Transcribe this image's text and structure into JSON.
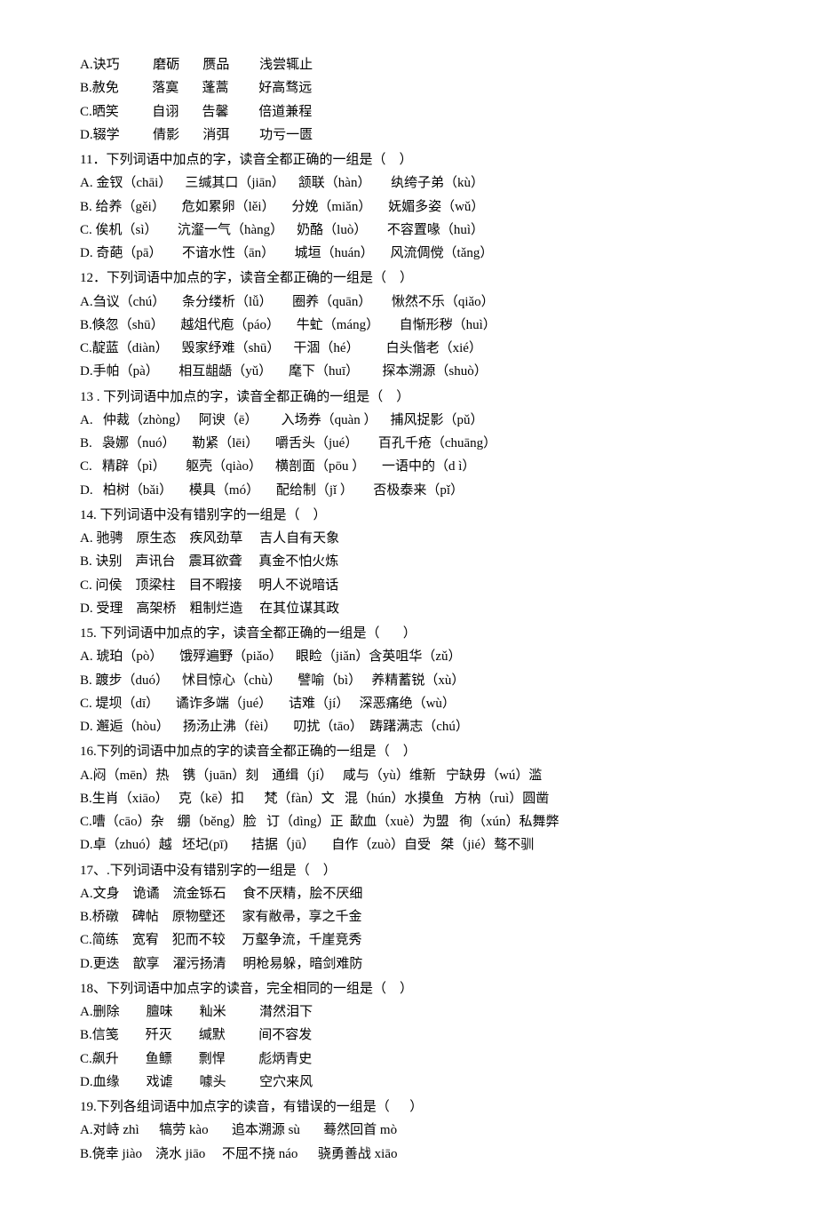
{
  "q10": {
    "optA": "A.诀巧          磨砺       赝品         浅尝辄止",
    "optB": "B.赦免          落寞       蓬蒿         好高骛远",
    "optC": "C.晒笑          自诩       告馨         倍道兼程",
    "optD": "D.辍学          倩影       消弭         功亏一匮"
  },
  "q11": {
    "stem": "11．下列词语中加点的字，读音全都正确的一组是（    ）",
    "optA": "A. 金钗（chāi）    三缄其口（jiān）    颔联（hàn）      纨绔子弟（kù）",
    "optB": "B. 给养（gěi）     危如累卵（lěi）     分娩（miǎn）     妩媚多姿（wǔ）",
    "optC": "C. 俟机（sì）      沆瀣一气（hàng）    奶酪（luò）      不容置喙（huì）",
    "optD": "D. 奇葩（pā）      不谙水性（ān）      城垣（huán）     风流倜傥（tǎng）"
  },
  "q12": {
    "stem": "12．下列词语中加点的字，读音全都正确的一组是（    ）",
    "optA": "A.刍议（chú）     条分缕析（lǚ）      圈养（quān）      愀然不乐（qiǎo）",
    "optB": "B.倏忽（shū）     越俎代庖（páo）     牛虻（máng）      自惭形秽（huì）",
    "optC": "C.靛蓝（diàn）    毁家纾难（shū）    干涸（hé）        白头偕老（xié）",
    "optD": "D.手帕（pà）      相互龃龉（yǔ）     麾下（huī）       探本溯源（shuò）"
  },
  "q13": {
    "stem": "13 . 下列词语中加点的字，读音全都正确的一组是（    ）",
    "optA": "A.   仲裁（zhòng）   阿谀（ē）       入场券（quàn ）    捕风捉影（pǔ）",
    "optB": "B.   袅娜（nuó）     勒紧（lēi）     嚼舌头（jué）      百孔千疮（chuāng）",
    "optC": "C.   精辟（pì）      躯壳（qiào）    横剖面（pōu ）     一语中的（d ì）",
    "optD": "D.   柏树（bǎi）     模具（mó）     配给制（jǐ ）      否极泰来（pǐ）"
  },
  "q14": {
    "stem": "14. 下列词语中没有错别字的一组是（    ）",
    "optA": "A. 驰骋    原生态    疾风劲草     吉人自有天象",
    "optB": "B. 诀别    声讯台    震耳欲聋     真金不怕火炼",
    "optC": "C. 问侯    顶梁柱    目不暇接     明人不说暗话",
    "optD": "D. 受理    高架桥    粗制烂造     在其位谋其政"
  },
  "q15": {
    "stem": "15. 下列词语中加点的字，读音全都正确的一组是（       ）",
    "optA": "A. 琥珀（pò）     饿殍遍野（piǎo）    眼睑（jiǎn）含英咀华（zǔ）",
    "optB": "B. 踱步（duó）    怵目惊心（chù）     譬喻（bì）   养精蓄锐（xù）",
    "optC": "C. 堤坝（dī）     谲诈多端（jué）     诘难（jí）   深恶痛绝（wù）",
    "optD": "D. 邂逅（hòu）    扬汤止沸（fèi）     叨扰（tāo）  踌躇满志（chú）"
  },
  "q16": {
    "stem": "16.下列的词语中加点的字的读音全都正确的一组是（    ）",
    "optA": "A.闷（mēn）热    镌（juān）刻    通缉（jí）   咸与（yù）维新   宁缺毋（wú）滥",
    "optB": "B.生肖（xiāo）   克（kē）扣      梵（fàn）文   混（hún）水摸鱼   方枘（ruì）圆凿",
    "optC": "C.嘈（cāo）杂    绷（běng）脸   订（dìng）正  歃血（xuè）为盟   徇（xún）私舞弊",
    "optD": "D.卓（zhuó）越   坯圮(pī)       拮据（jū）     自作（zuò）自受   桀（jié）骜不驯"
  },
  "q17": {
    "stem": "17、.下列词语中没有错别字的一组是（    ）",
    "optA": "A.文身    诡谲    流金铄石     食不厌精，脍不厌细",
    "optB": "B.桥礅    碑帖    原物壁还     家有敝帚，享之千金",
    "optC": "C.简练    宽宥    犯而不较     万壑争流，千崖竞秀",
    "optD": "D.更迭    歆享    濯污扬清     明枪易躲，暗剑难防"
  },
  "q18": {
    "stem": "18、下列词语中加点字的读音，完全相同的一组是（    ）",
    "optA": "A.删除        膻味        籼米          潸然泪下",
    "optB": "B.信笺        歼灭        缄默          间不容发",
    "optC": "C.飙升        鱼鳔        剽悍          彪炳青史",
    "optD": "D.血缘        戏谑        噱头          空穴来风"
  },
  "q19": {
    "stem": "19.下列各组词语中加点字的读音，有错误的一组是（      ）",
    "optA": "A.对峙 zhì      犒劳 kào       追本溯源 sù       蓦然回首 mò",
    "optB": "B.侥幸 jiào    浇水 jiāo     不屈不挠 náo      骁勇善战 xiāo"
  }
}
